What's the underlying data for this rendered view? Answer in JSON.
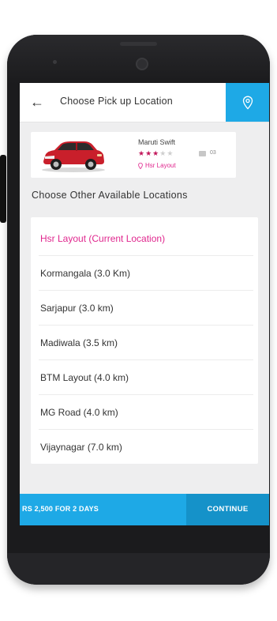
{
  "header": {
    "title": "Choose Pick up Location",
    "back_icon": "arrow-left-icon",
    "location_icon": "map-pin-icon"
  },
  "car": {
    "name": "Maruti Swift",
    "rating": 3,
    "max_rating": 5,
    "seats": "03",
    "location": "Hsr Layout",
    "image_icon": "red-hatchback-car"
  },
  "section": {
    "title": "Choose Other Available Locations"
  },
  "locations": [
    {
      "label": "Hsr Layout (Current Location)",
      "current": true
    },
    {
      "label": "Kormangala (3.0 Km)",
      "current": false
    },
    {
      "label": "Sarjapur (3.0 km)",
      "current": false
    },
    {
      "label": "Madiwala (3.5 km)",
      "current": false
    },
    {
      "label": "BTM Layout (4.0 km)",
      "current": false
    },
    {
      "label": "MG Road (4.0 km)",
      "current": false
    },
    {
      "label": "Vijaynagar (7.0 km)",
      "current": false
    }
  ],
  "footer": {
    "price_label": "RS 2,500 FOR 2 DAYS",
    "continue_label": "CONTINUE"
  },
  "colors": {
    "accent_blue": "#1ea9e6",
    "accent_blue_dark": "#1592c9",
    "accent_pink": "#e0278e",
    "star_color": "#c2185b"
  }
}
